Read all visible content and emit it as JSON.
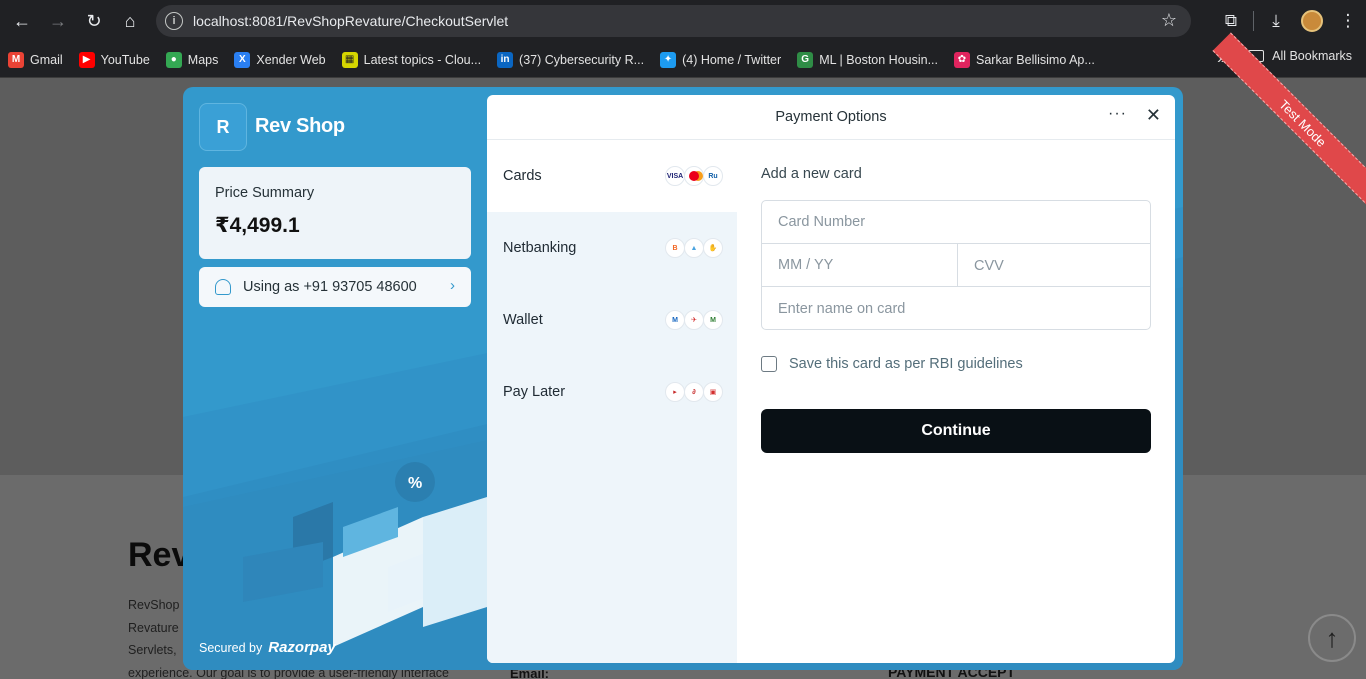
{
  "browser": {
    "url": "localhost:8081/RevShopRevature/CheckoutServlet",
    "bookmarks": [
      {
        "label": "Gmail",
        "icon": "gmail-icon",
        "color": "#ea4335"
      },
      {
        "label": "YouTube",
        "icon": "youtube-icon",
        "color": "#ff0000"
      },
      {
        "label": "Maps",
        "icon": "maps-icon",
        "color": "#34a853"
      },
      {
        "label": "Xender Web",
        "icon": "xender-icon",
        "color": "#2a7ff2"
      },
      {
        "label": "Latest topics - Clou...",
        "icon": "forum-icon",
        "color": "#d6d600"
      },
      {
        "label": "(37) Cybersecurity R...",
        "icon": "linkedin-icon",
        "color": "#0a66c2"
      },
      {
        "label": "(4) Home / Twitter",
        "icon": "twitter-icon",
        "color": "#1d9bf0"
      },
      {
        "label": "ML | Boston Housin...",
        "icon": "gfg-icon",
        "color": "#2f8d46"
      },
      {
        "label": "Sarkar Bellisimo Ap...",
        "icon": "app-icon",
        "color": "#e0245e"
      }
    ],
    "all_bookmarks": "All Bookmarks"
  },
  "page": {
    "heading": "Rev",
    "paragraph_lines": [
      "RevShop",
      "Revature",
      "Servlets,",
      "experience. Our goal is to provide a user-friendly interface"
    ],
    "email_label": "Email:",
    "payment_label": "PAYMENT ACCEPT",
    "test_mode": "Test Mode"
  },
  "checkout": {
    "logo_letter": "R",
    "brand": "Rev Shop",
    "price_summary_label": "Price Summary",
    "price": "₹4,499.1",
    "using_as": "Using as +91 93705 48600",
    "secured_by": "Secured by",
    "razorpay": "Razorpay",
    "panel_title": "Payment Options",
    "methods": [
      {
        "label": "Cards",
        "icons": [
          "visa-icon",
          "mastercard-icon",
          "rupay-icon"
        ]
      },
      {
        "label": "Netbanking",
        "icons": [
          "bank-icon",
          "bank-icon",
          "bank-icon"
        ]
      },
      {
        "label": "Wallet",
        "icons": [
          "wallet-icon",
          "wallet-icon",
          "wallet-icon"
        ]
      },
      {
        "label": "Pay Later",
        "icons": [
          "paylater-icon",
          "paylater-icon",
          "paylater-icon"
        ]
      }
    ],
    "add_card_title": "Add a new card",
    "card_number_placeholder": "Card Number",
    "expiry_placeholder": "MM / YY",
    "cvv_placeholder": "CVV",
    "name_placeholder": "Enter name on card",
    "save_card_label": "Save this card as per RBI guidelines",
    "continue_label": "Continue"
  }
}
